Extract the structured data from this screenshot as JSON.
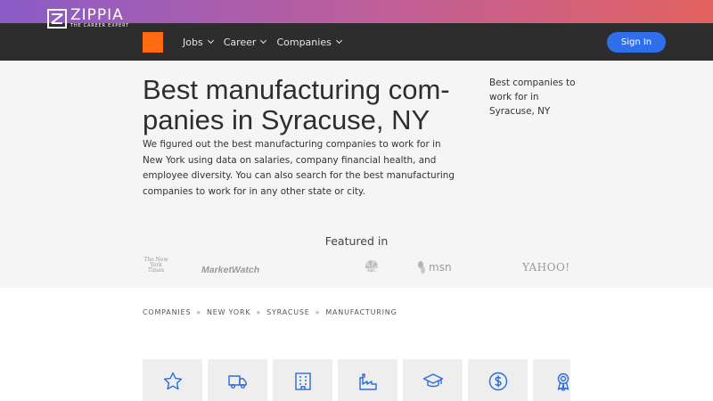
{
  "header": {
    "logo_word": "ZIPPIA",
    "logo_tagline": "THE CAREER EXPERT",
    "nav": [
      {
        "label": "Jobs"
      },
      {
        "label": "Career"
      },
      {
        "label": "Companies"
      }
    ],
    "signin_label": "Sign In"
  },
  "hero": {
    "title": "Best manufacturing com-panies in Syracuse, NY",
    "description": "We figured out the best manufacturing companies to work for in New York using data on salaries, company financial health, and employee diversity. You can also search for the best manufacturing companies to work for in any other state or city.",
    "side_link": "Best companies to work for in Syracuse, NY"
  },
  "featured": {
    "title": "Featured in",
    "logos": {
      "nyt": "The New York Times",
      "marketwatch": "MarketWatch",
      "nbc": "NBC",
      "msn": "msn",
      "yahoo": "YAHOO!"
    }
  },
  "breadcrumb": [
    "COMPANIES",
    "NEW YORK",
    "SYRACUSE",
    "MANUFACTURING"
  ],
  "breadcrumb_sep": "»",
  "categories": [
    {
      "icon": "star-icon"
    },
    {
      "icon": "truck-icon"
    },
    {
      "icon": "building-icon"
    },
    {
      "icon": "factory-icon"
    },
    {
      "icon": "graduation-cap-icon"
    },
    {
      "icon": "dollar-icon"
    },
    {
      "icon": "award-ribbon-icon"
    }
  ],
  "colors": {
    "accent_blue": "#2f6fec",
    "icon_blue": "#2a6bd8",
    "logo_orange": "#ff6a13",
    "nav_bg": "#2d2d2d"
  }
}
